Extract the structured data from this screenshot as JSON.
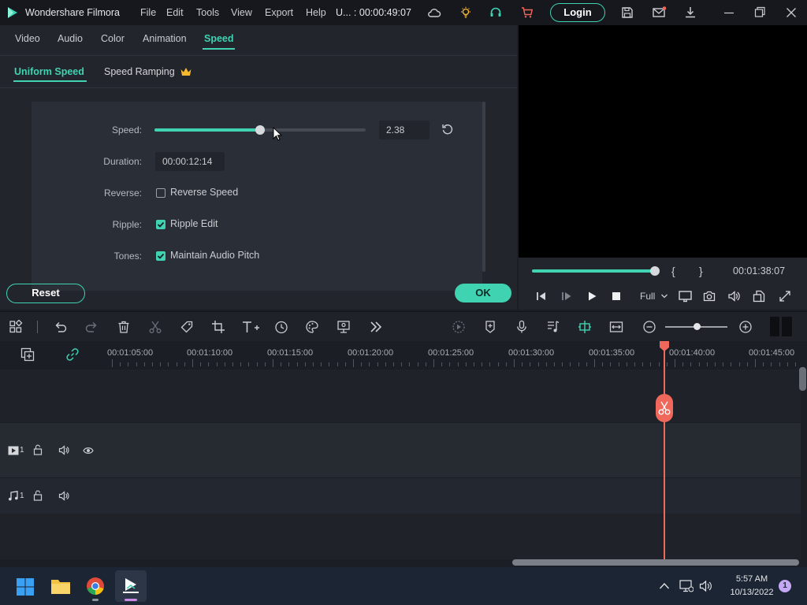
{
  "app": {
    "title": "Wondershare Filmora",
    "menu": [
      "File",
      "Edit",
      "Tools",
      "View",
      "Export",
      "Help"
    ],
    "project_timecode": "U... : 00:00:49:07",
    "login_label": "Login"
  },
  "tabs": {
    "items": [
      "Video",
      "Audio",
      "Color",
      "Animation",
      "Speed"
    ],
    "active": "Speed"
  },
  "subtabs": {
    "uniform": "Uniform Speed",
    "ramping": "Speed Ramping"
  },
  "speed": {
    "label": "Speed:",
    "value": "2.38",
    "slider_fraction": 0.5
  },
  "duration": {
    "label": "Duration:",
    "value": "00:00:12:14"
  },
  "reverse": {
    "label": "Reverse:",
    "option": "Reverse Speed",
    "checked": false
  },
  "ripple": {
    "label": "Ripple:",
    "option": "Ripple Edit",
    "checked": true
  },
  "tones": {
    "label": "Tones:",
    "option": "Maintain Audio Pitch",
    "checked": true
  },
  "buttons": {
    "reset": "Reset",
    "ok": "OK"
  },
  "preview": {
    "timecode": "00:01:38:07",
    "progress_fraction": 1.0,
    "quality": "Full",
    "brace_open": "{",
    "brace_close": "}"
  },
  "timeline": {
    "ruler": [
      "00:01:05:00",
      "00:01:10:00",
      "00:01:15:00",
      "00:01:20:00",
      "00:01:25:00",
      "00:01:30:00",
      "00:01:35:00",
      "00:01:40:00",
      "00:01:45:00"
    ],
    "video_track_num": "1",
    "audio_track_num": "1",
    "zoom_fraction": 0.5
  },
  "taskbar": {
    "time": "5:57 AM",
    "date": "10/13/2022",
    "notifications": "1"
  },
  "colors": {
    "accent": "#3fd3b2",
    "playhead": "#f0675b",
    "background": "#1b1e24"
  }
}
